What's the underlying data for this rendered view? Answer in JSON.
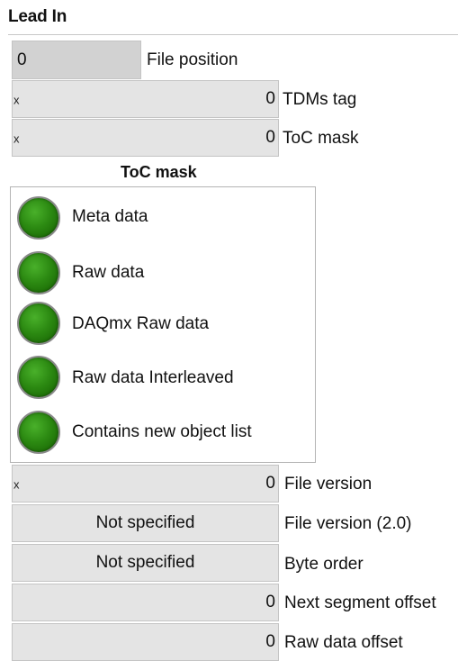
{
  "group": {
    "title": "Lead In"
  },
  "file_position": {
    "value": "0",
    "label": "File position"
  },
  "tdms_tag": {
    "radix": "x",
    "value": "0",
    "label": "TDMs tag"
  },
  "toc_mask_field": {
    "radix": "x",
    "value": "0",
    "label": "ToC mask"
  },
  "toc_cluster": {
    "title": "ToC mask",
    "items": [
      {
        "label": "Meta data",
        "led_color": "#2c8a12"
      },
      {
        "label": "Raw data",
        "led_color": "#2c8a12"
      },
      {
        "label": "DAQmx Raw data",
        "led_color": "#2c8a12"
      },
      {
        "label": "Raw data Interleaved",
        "led_color": "#2c8a12"
      },
      {
        "label": "Contains new object list",
        "led_color": "#2c8a12"
      }
    ]
  },
  "file_version": {
    "radix": "x",
    "value": "0",
    "label": "File version"
  },
  "file_version_2": {
    "value": "Not specified",
    "label": "File version (2.0)"
  },
  "byte_order": {
    "value": "Not specified",
    "label": "Byte order"
  },
  "next_segment_offset": {
    "value": "0",
    "label": "Next segment offset"
  },
  "raw_data_offset": {
    "value": "0",
    "label": "Raw data offset"
  }
}
